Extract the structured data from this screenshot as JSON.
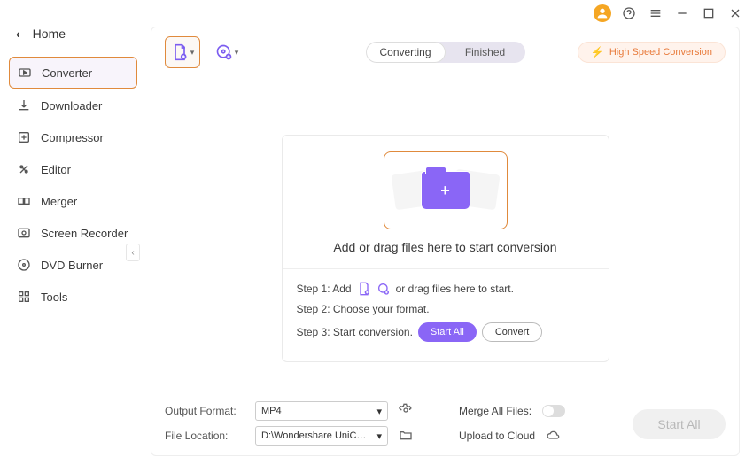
{
  "titlebar": {
    "home": "Home"
  },
  "sidebar": {
    "items": [
      {
        "label": "Converter"
      },
      {
        "label": "Downloader"
      },
      {
        "label": "Compressor"
      },
      {
        "label": "Editor"
      },
      {
        "label": "Merger"
      },
      {
        "label": "Screen Recorder"
      },
      {
        "label": "DVD Burner"
      },
      {
        "label": "Tools"
      }
    ]
  },
  "tabs": {
    "converting": "Converting",
    "finished": "Finished"
  },
  "speed": "High Speed Conversion",
  "drop": {
    "hint": "Add or drag files here to start conversion"
  },
  "steps": {
    "s1a": "Step 1: Add",
    "s1b": "or drag files here to start.",
    "s2": "Step 2: Choose your format.",
    "s3": "Step 3: Start conversion.",
    "startall": "Start All",
    "convert": "Convert"
  },
  "footer": {
    "outputFormatLabel": "Output Format:",
    "outputFormatValue": "MP4",
    "fileLocationLabel": "File Location:",
    "fileLocationValue": "D:\\Wondershare UniConverter 1",
    "mergeLabel": "Merge All Files:",
    "uploadLabel": "Upload to Cloud",
    "startAll": "Start All"
  }
}
